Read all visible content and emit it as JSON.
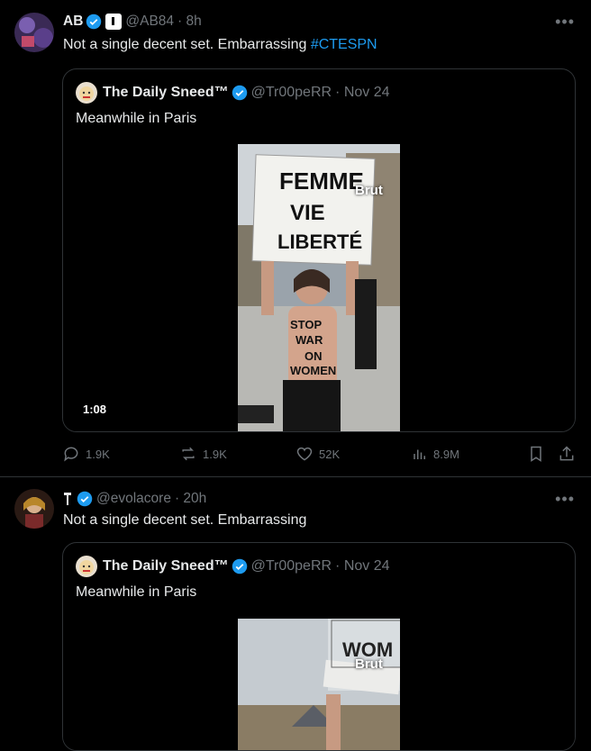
{
  "tweet1": {
    "name": "AB",
    "handle": "@AB84",
    "time": "· 8h",
    "text": "Not a single decent set. Embarrassing ",
    "hashtag": "#CTESPN",
    "quote": {
      "name": "The Daily Sneed™",
      "handle": "@Tr00peRR",
      "time": "· Nov 24",
      "text": "Meanwhile in Paris",
      "video_duration": "1:08",
      "watermark": "Brut",
      "sign_text": [
        "FEMME",
        "VIE",
        "LIBERTÉ"
      ],
      "body_text": [
        "STOP",
        "WAR",
        "ON",
        "WOMEN"
      ]
    },
    "actions": {
      "replies": "1.9K",
      "reposts": "1.9K",
      "likes": "52K",
      "views": "8.9M"
    }
  },
  "tweet2": {
    "name": "",
    "handle": "@evolacore",
    "time": "· 20h",
    "text": "Not a single decent set. Embarrassing",
    "quote": {
      "name": "The Daily Sneed™",
      "handle": "@Tr00peRR",
      "time": "· Nov 24",
      "text": "Meanwhile in Paris",
      "watermark": "Brut",
      "sign_text": "WOM"
    }
  },
  "colors": {
    "accent": "#1d9bf0",
    "muted": "#71767b",
    "border": "#2f3336",
    "background": "#000000"
  }
}
